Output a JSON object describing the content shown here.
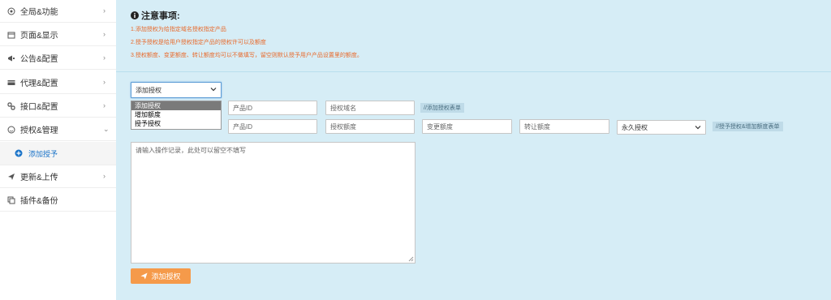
{
  "sidebar": {
    "items": [
      {
        "label": "全局&功能",
        "icon": "globe-icon"
      },
      {
        "label": "页面&显示",
        "icon": "page-icon"
      },
      {
        "label": "公告&配置",
        "icon": "megaphone-icon"
      },
      {
        "label": "代理&配置",
        "icon": "credit-card-icon"
      },
      {
        "label": "接口&配置",
        "icon": "link-icon"
      },
      {
        "label": "授权&管理",
        "icon": "smile-icon"
      },
      {
        "label": "添加授予",
        "icon": "plus-circle-icon"
      },
      {
        "label": "更新&上传",
        "icon": "send-icon"
      },
      {
        "label": "插件&备份",
        "icon": "copy-icon"
      }
    ]
  },
  "notice": {
    "title": "注意事项:",
    "lines": [
      "1.添加授权为给指定域名授权指定产品",
      "2.授予授权是给用户授权指定产品的授权许可以及额度",
      "3.授权额度、变更额度、转让额度均可以不做填写，留空则默认授予用户产品设置里的额度。"
    ]
  },
  "form": {
    "action_select": "添加授权",
    "action_options": [
      "添加授权",
      "增加额度",
      "授予授权"
    ],
    "row1": {
      "product_id_placeholder": "产品ID",
      "domain_placeholder": "授权域名",
      "hint": "//添加授权表单"
    },
    "row2": {
      "product_id_placeholder": "产品ID",
      "quota_placeholder": "授权额度",
      "change_quota_placeholder": "变更额度",
      "transfer_quota_placeholder": "转让额度",
      "type_select": "永久授权",
      "hint": "//授予授权&增加额度表单"
    },
    "note_placeholder": "请输入操作记录，此处可以留空不填写",
    "submit_label": "添加授权"
  },
  "colors": {
    "main_bg": "#d6edf6",
    "notice_text": "#e86a2c",
    "submit_btn": "#f59a4a",
    "active_sub": "#1a73c8"
  }
}
